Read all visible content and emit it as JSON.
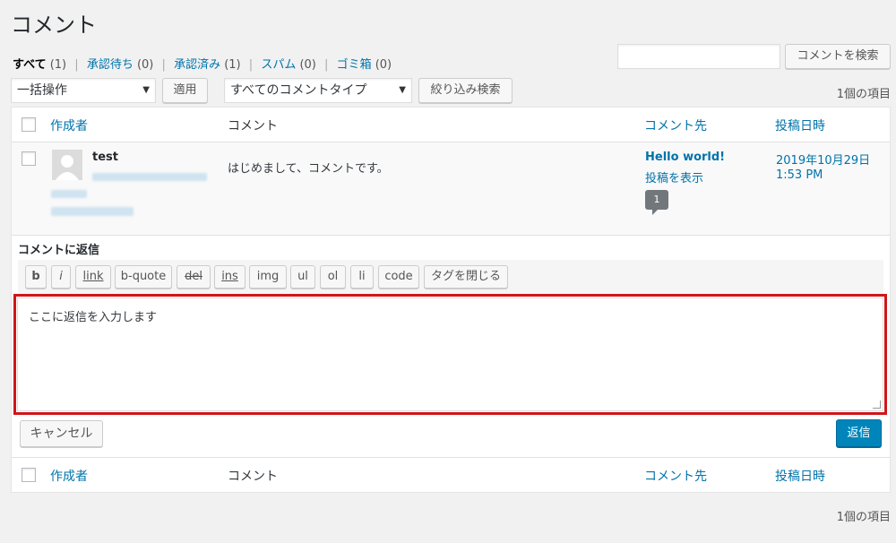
{
  "page": {
    "title": "コメント"
  },
  "filters": [
    {
      "label": "すべて",
      "count": "(1)",
      "current": true
    },
    {
      "label": "承認待ち",
      "count": "(0)"
    },
    {
      "label": "承認済み",
      "count": "(1)"
    },
    {
      "label": "スパム",
      "count": "(0)"
    },
    {
      "label": "ゴミ箱",
      "count": "(0)"
    }
  ],
  "search": {
    "value": "",
    "button_label": "コメントを検索"
  },
  "bulk": {
    "selected": "一括操作",
    "apply_label": "適用"
  },
  "type_filter": {
    "selected": "すべてのコメントタイプ",
    "button_label": "絞り込み検索"
  },
  "item_count": "1個の項目",
  "table": {
    "headers": {
      "author": "作成者",
      "comment": "コメント",
      "response": "コメント先",
      "date": "投稿日時"
    }
  },
  "comment": {
    "author_name": "test",
    "text": "はじめまして、コメントです。",
    "response_title": "Hello world!",
    "response_view": "投稿を表示",
    "comment_count": "1",
    "date": "2019年10月29日",
    "time": "1:53 PM"
  },
  "reply": {
    "heading": "コメントに返信",
    "toolbar": [
      "b",
      "i",
      "link",
      "b-quote",
      "del",
      "ins",
      "img",
      "ul",
      "ol",
      "li",
      "code",
      "タグを閉じる"
    ],
    "text": "ここに返信を入力します",
    "cancel_label": "キャンセル",
    "submit_label": "返信"
  },
  "colors": {
    "link": "#0073aa",
    "highlight_border": "#d0151b",
    "primary": "#0085ba"
  }
}
